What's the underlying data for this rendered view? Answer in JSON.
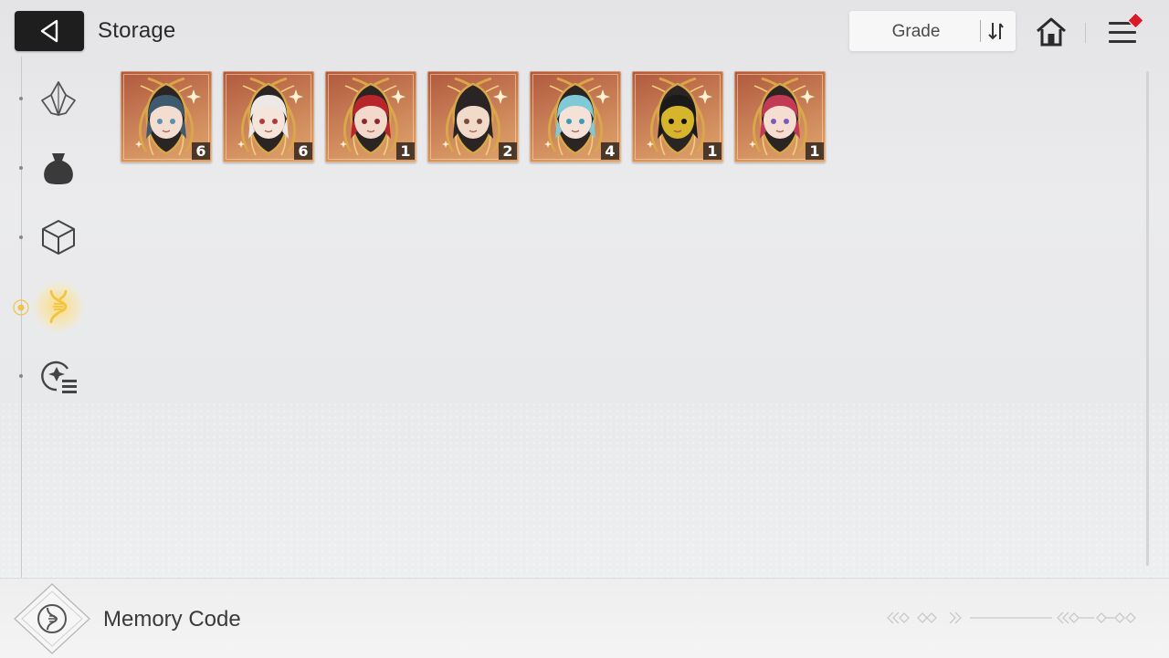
{
  "header": {
    "title": "Storage",
    "sort_label": "Grade"
  },
  "sidebar": {
    "items": [
      {
        "name": "crystal",
        "icon": "crystal-icon",
        "active": false
      },
      {
        "name": "materials",
        "icon": "bag-icon",
        "active": false
      },
      {
        "name": "boxes",
        "icon": "cube-icon",
        "active": false
      },
      {
        "name": "memory-code",
        "icon": "dna-icon",
        "active": true
      },
      {
        "name": "other",
        "icon": "gear-list-icon",
        "active": false
      }
    ]
  },
  "items": [
    {
      "count": "6",
      "hair": "#3f5a6e",
      "skin": "#f3dcd0",
      "eyes": "#5d8fb0"
    },
    {
      "count": "6",
      "hair": "#ece8e6",
      "skin": "#f5e4da",
      "eyes": "#b03a3a"
    },
    {
      "count": "1",
      "hair": "#b8262b",
      "skin": "#f3d9cc",
      "eyes": "#8a2a2a"
    },
    {
      "count": "2",
      "hair": "#2b2426",
      "skin": "#f2dacb",
      "eyes": "#7a4a3a"
    },
    {
      "count": "4",
      "hair": "#7fcad6",
      "skin": "#f4e2d8",
      "eyes": "#3d9ab0"
    },
    {
      "count": "1",
      "hair": "#1a1a1a",
      "skin": "#d6b42c",
      "eyes": "#111"
    },
    {
      "count": "1",
      "hair": "#c23a55",
      "skin": "#f5ddd2",
      "eyes": "#7b5bb5"
    }
  ],
  "footer": {
    "title": "Memory Code"
  },
  "colors": {
    "card_gold": "#d9a64a",
    "notify": "#d91a28",
    "active_glow": "#ffda6e"
  }
}
